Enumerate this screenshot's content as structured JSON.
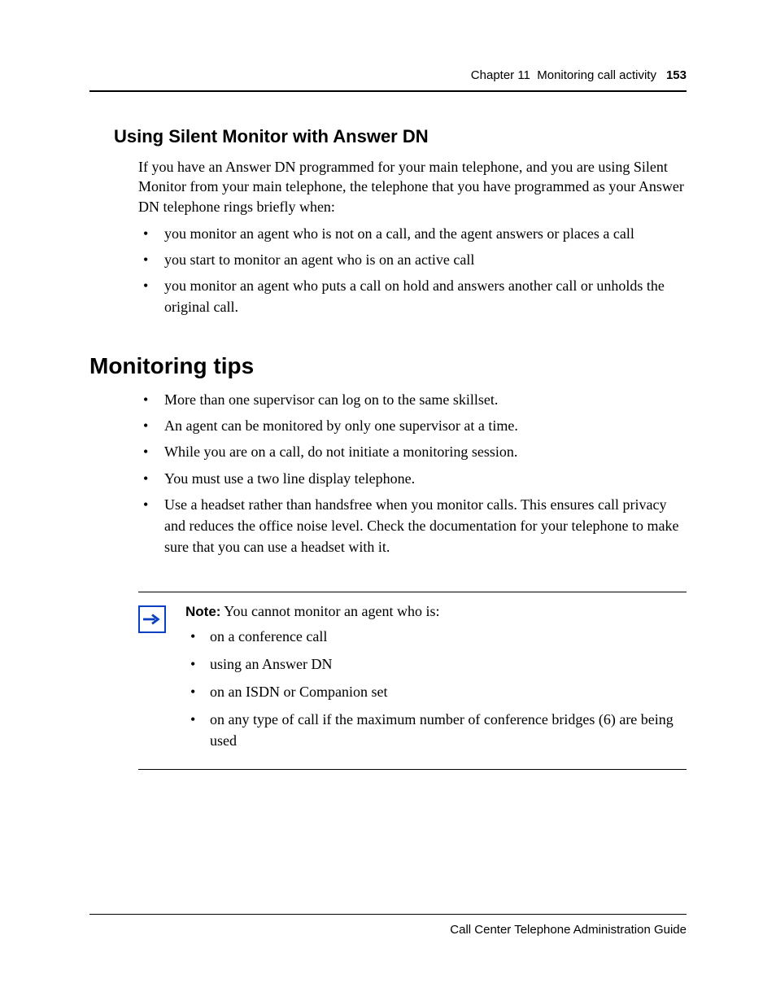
{
  "header": {
    "chapter": "Chapter 11",
    "title": "Monitoring call activity",
    "page": "153"
  },
  "section1": {
    "heading": "Using Silent Monitor with Answer DN",
    "intro": "If you have an Answer DN programmed for your main telephone, and you are using Silent Monitor from your main telephone, the telephone that you have programmed as your Answer DN telephone rings briefly when:",
    "bullets": [
      "you monitor an agent who is not on a call, and the agent answers or places a call",
      "you start to monitor an agent who is on an active call",
      "you monitor an agent who puts a call on hold and answers another call or unholds the original call."
    ]
  },
  "section2": {
    "heading": "Monitoring tips",
    "bullets": [
      "More than one supervisor can log on to the same skillset.",
      "An agent can be monitored by only one supervisor at a time.",
      "While you are on a call, do not initiate a monitoring session.",
      "You must use a two line display telephone.",
      "Use a headset rather than handsfree when you monitor calls. This ensures call privacy and reduces the office noise level. Check the documentation for your telephone to make sure that you can use a headset with it."
    ]
  },
  "note": {
    "label": "Note:",
    "lead": "You cannot monitor an agent who is:",
    "bullets": [
      "on a conference call",
      "using an Answer DN",
      "on an ISDN or Companion set",
      "on any type of call if the maximum number of conference bridges (6) are being used"
    ]
  },
  "footer": {
    "text": "Call Center Telephone Administration Guide"
  }
}
